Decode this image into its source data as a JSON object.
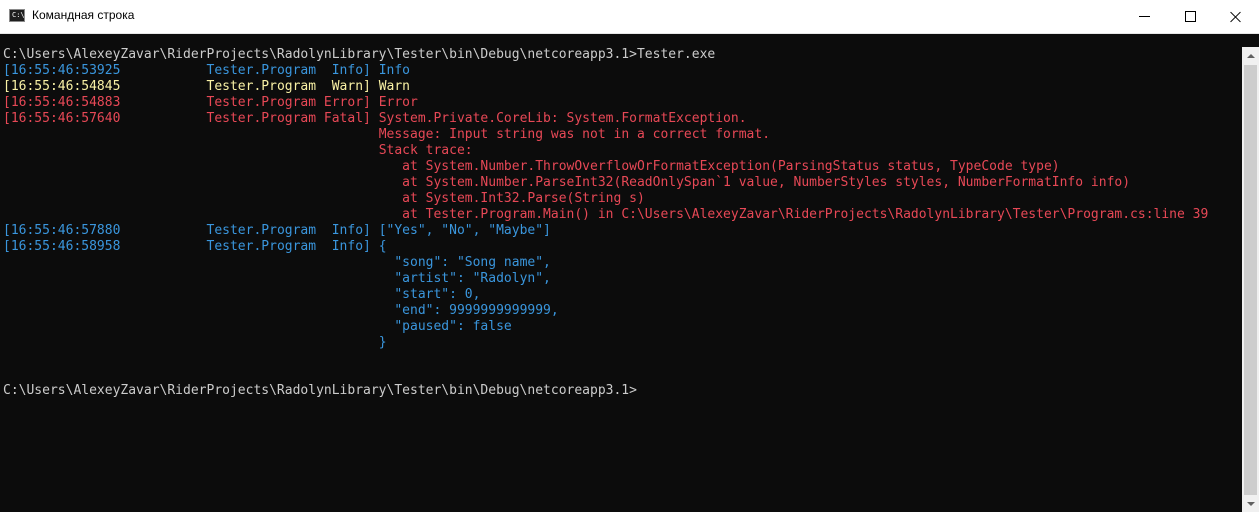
{
  "window": {
    "title": "Командная строка"
  },
  "colors": {
    "background": "#0c0c0c",
    "default": "#cccccc",
    "info": "#3a96dd",
    "info_text": "#3a96dd",
    "program": "#3a96dd",
    "warn": "#f9f1a5",
    "error": "#e74856",
    "fatal": "#e74856",
    "json": "#3a96dd"
  },
  "console": {
    "lines": [
      {
        "segments": [
          {
            "text": "C:\\Users\\AlexeyZavar\\RiderProjects\\RadolynLibrary\\Tester\\bin\\Debug\\netcoreapp3.1>Tester.exe",
            "color": "#cccccc"
          }
        ]
      },
      {
        "segments": [
          {
            "text": "[16:55:46:53925",
            "color": "#3a96dd"
          },
          {
            "text": "           Tester.Program  Info] ",
            "color": "#3a96dd"
          },
          {
            "text": "Info",
            "color": "#3a96dd"
          }
        ]
      },
      {
        "segments": [
          {
            "text": "[16:55:46:54845",
            "color": "#f9f1a5"
          },
          {
            "text": "           Tester.Program  Warn] ",
            "color": "#f9f1a5"
          },
          {
            "text": "Warn",
            "color": "#f9f1a5"
          }
        ]
      },
      {
        "segments": [
          {
            "text": "[16:55:46:54883",
            "color": "#e74856"
          },
          {
            "text": "           Tester.Program Error] ",
            "color": "#e74856"
          },
          {
            "text": "Error",
            "color": "#e74856"
          }
        ]
      },
      {
        "segments": [
          {
            "text": "[16:55:46:57640",
            "color": "#e74856"
          },
          {
            "text": "           Tester.Program Fatal] ",
            "color": "#e74856"
          },
          {
            "text": "System.Private.CoreLib: System.FormatException.",
            "color": "#e74856"
          }
        ]
      },
      {
        "segments": [
          {
            "text": "                                                ",
            "color": "#e74856"
          },
          {
            "text": "Message: Input string was not in a correct format.",
            "color": "#e74856"
          }
        ]
      },
      {
        "segments": [
          {
            "text": "                                                ",
            "color": "#e74856"
          },
          {
            "text": "Stack trace:",
            "color": "#e74856"
          }
        ]
      },
      {
        "segments": [
          {
            "text": "                                                ",
            "color": "#e74856"
          },
          {
            "text": "   at System.Number.ThrowOverflowOrFormatException(ParsingStatus status, TypeCode type)",
            "color": "#e74856"
          }
        ]
      },
      {
        "segments": [
          {
            "text": "                                                ",
            "color": "#e74856"
          },
          {
            "text": "   at System.Number.ParseInt32(ReadOnlySpan`1 value, NumberStyles styles, NumberFormatInfo info)",
            "color": "#e74856"
          }
        ]
      },
      {
        "segments": [
          {
            "text": "                                                ",
            "color": "#e74856"
          },
          {
            "text": "   at System.Int32.Parse(String s)",
            "color": "#e74856"
          }
        ]
      },
      {
        "segments": [
          {
            "text": "                                                ",
            "color": "#e74856"
          },
          {
            "text": "   at Tester.Program.Main() in C:\\Users\\AlexeyZavar\\RiderProjects\\RadolynLibrary\\Tester\\Program.cs:line 39",
            "color": "#e74856"
          }
        ]
      },
      {
        "segments": [
          {
            "text": "[16:55:46:57880",
            "color": "#3a96dd"
          },
          {
            "text": "           Tester.Program  Info] ",
            "color": "#3a96dd"
          },
          {
            "text": "[\"Yes\", \"No\", \"Maybe\"]",
            "color": "#3a96dd"
          }
        ]
      },
      {
        "segments": [
          {
            "text": "[16:55:46:58958",
            "color": "#3a96dd"
          },
          {
            "text": "           Tester.Program  Info] ",
            "color": "#3a96dd"
          },
          {
            "text": "{",
            "color": "#3a96dd"
          }
        ]
      },
      {
        "segments": [
          {
            "text": "                                                ",
            "color": "#3a96dd"
          },
          {
            "text": "  \"song\": \"Song name\",",
            "color": "#3a96dd"
          }
        ]
      },
      {
        "segments": [
          {
            "text": "                                                ",
            "color": "#3a96dd"
          },
          {
            "text": "  \"artist\": \"Radolyn\",",
            "color": "#3a96dd"
          }
        ]
      },
      {
        "segments": [
          {
            "text": "                                                ",
            "color": "#3a96dd"
          },
          {
            "text": "  \"start\": 0,",
            "color": "#3a96dd"
          }
        ]
      },
      {
        "segments": [
          {
            "text": "                                                ",
            "color": "#3a96dd"
          },
          {
            "text": "  \"end\": 9999999999999,",
            "color": "#3a96dd"
          }
        ]
      },
      {
        "segments": [
          {
            "text": "                                                ",
            "color": "#3a96dd"
          },
          {
            "text": "  \"paused\": false",
            "color": "#3a96dd"
          }
        ]
      },
      {
        "segments": [
          {
            "text": "                                                ",
            "color": "#3a96dd"
          },
          {
            "text": "}",
            "color": "#3a96dd"
          }
        ]
      },
      {
        "segments": [
          {
            "text": "",
            "color": "#cccccc"
          }
        ]
      },
      {
        "segments": [
          {
            "text": "",
            "color": "#cccccc"
          }
        ]
      },
      {
        "segments": [
          {
            "text": "C:\\Users\\AlexeyZavar\\RiderProjects\\RadolynLibrary\\Tester\\bin\\Debug\\netcoreapp3.1>",
            "color": "#cccccc"
          }
        ]
      }
    ]
  }
}
